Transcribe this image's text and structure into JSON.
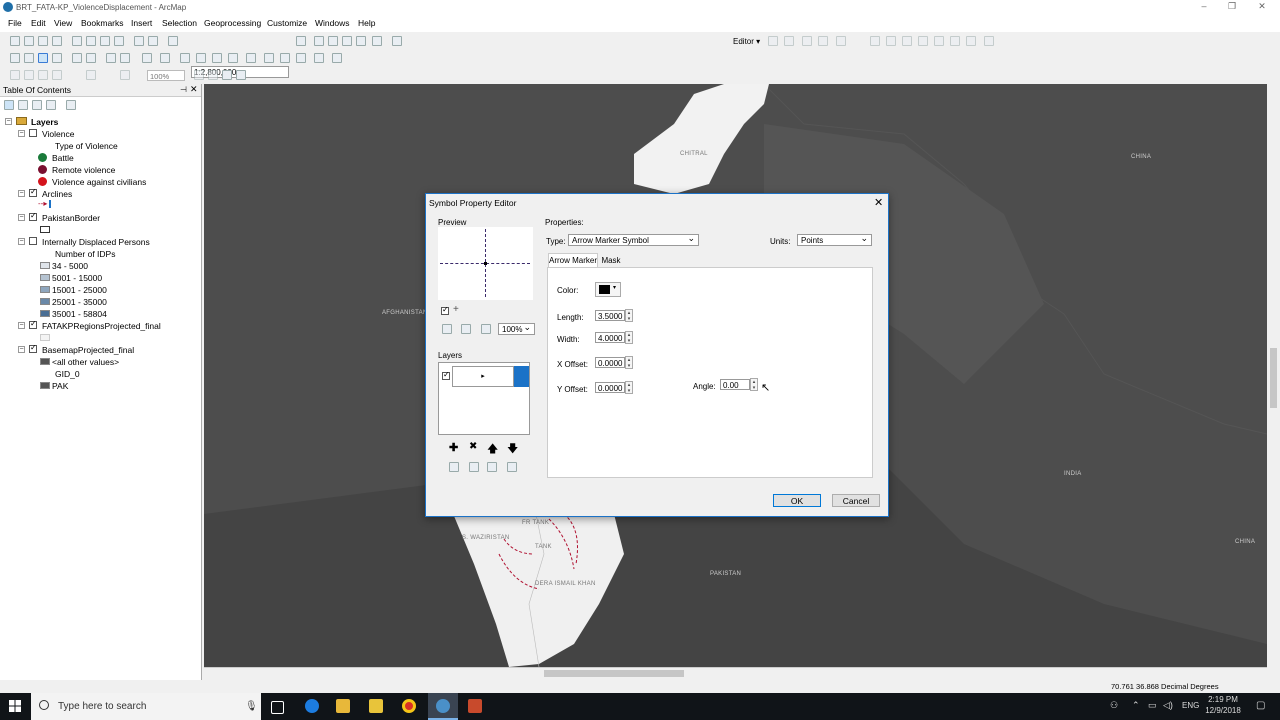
{
  "window": {
    "title": "BRT_FATA-KP_ViolenceDisplacement - ArcMap"
  },
  "menu": [
    "File",
    "Edit",
    "View",
    "Bookmarks",
    "Insert",
    "Selection",
    "Geoprocessing",
    "Customize",
    "Windows",
    "Help"
  ],
  "toolbar": {
    "scale": "1:2,800,000",
    "zoom": "100%",
    "editor_label": "Editor ▾"
  },
  "toc": {
    "title": "Table Of Contents",
    "root": "Layers",
    "violence": {
      "name": "Violence",
      "field": "Type of Violence",
      "classes": [
        "Battle",
        "Remote violence",
        "Violence against civilians"
      ],
      "colors": [
        "#1a7a3a",
        "#7a1030",
        "#d4141c"
      ]
    },
    "arclines": {
      "name": "Arclines"
    },
    "border": {
      "name": "PakistanBorder"
    },
    "idp": {
      "name": "Internally Displaced Persons",
      "field": "Number of IDPs",
      "classes": [
        "34 - 5000",
        "5001 - 15000",
        "15001 - 25000",
        "25001 - 35000",
        "35001 - 58804"
      ],
      "colors": [
        "#dfe4ea",
        "#b5c3d1",
        "#8fa6bd",
        "#6a89a8",
        "#4a6e94"
      ]
    },
    "fata": {
      "name": "FATAKPRegionsProjected_final"
    },
    "basemap": {
      "name": "BasemapProjected_final",
      "other": "<all other values>",
      "field": "GID_0",
      "value": "PAK"
    }
  },
  "map": {
    "labels": {
      "chitral": "CHITRAL",
      "china1": "CHINA",
      "china2": "CHINA",
      "afghanistan": "AFGHANISTAN",
      "india": "INDIA",
      "pakistan": "PAKISTAN",
      "swaz": "S. WAZIRISTAN",
      "tank": "TANK",
      "frtank": "FR TANK",
      "dik": "DERA ISMAIL KHAN"
    }
  },
  "dialog": {
    "title": "Symbol Property Editor",
    "preview_label": "Preview",
    "zoom": "100%",
    "layers_label": "Layers",
    "properties_label": "Properties:",
    "type_label": "Type:",
    "type_value": "Arrow Marker Symbol",
    "units_label": "Units:",
    "units_value": "Points",
    "tabs": [
      "Arrow Marker",
      "Mask"
    ],
    "color_label": "Color:",
    "length_label": "Length:",
    "length": "3.5000",
    "width_label": "Width:",
    "width": "4.0000",
    "xoff_label": "X Offset:",
    "xoff": "0.0000",
    "yoff_label": "Y Offset:",
    "yoff": "0.0000",
    "angle_label": "Angle:",
    "angle": "0.00",
    "ok": "OK",
    "cancel": "Cancel"
  },
  "status": {
    "coords": "70.761  36.868 Decimal Degrees"
  },
  "taskbar": {
    "search_placeholder": "Type here to search",
    "lang": "ENG",
    "time": "2:19 PM",
    "date": "12/9/2018"
  }
}
